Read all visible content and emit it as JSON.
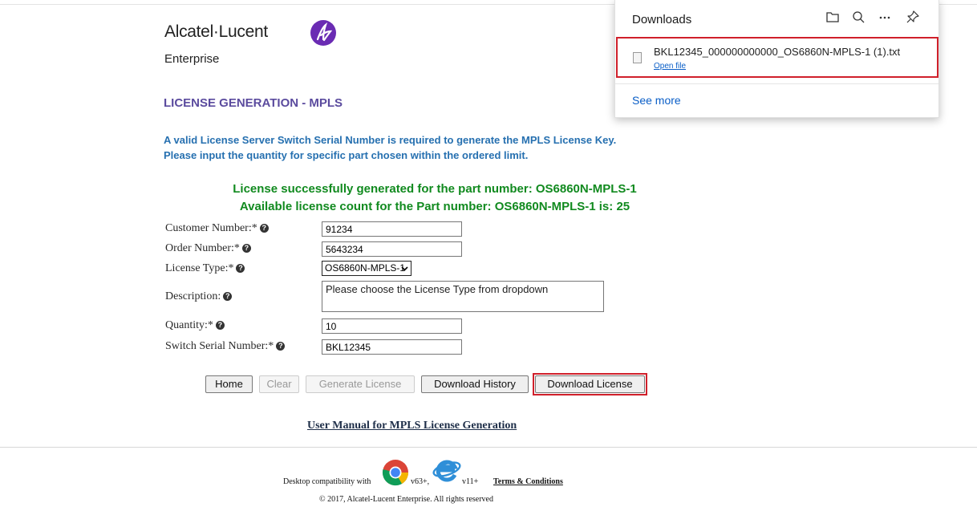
{
  "logo": {
    "brand": "Alcatel·Lucent",
    "sub": "Enterprise",
    "brand_color": "#6a2bb3"
  },
  "page": {
    "title": "LICENSE GENERATION - MPLS",
    "intro_line1": "A valid License Server Switch Serial Number is required to generate the MPLS License Key.",
    "intro_line2": "Please input the quantity for specific part chosen within the ordered limit.",
    "success_line1": "License successfully generated for the part number: OS6860N-MPLS-1",
    "success_line2": "Available license count for the Part number: OS6860N-MPLS-1 is: 25"
  },
  "form": {
    "customer_number": {
      "label": "Customer Number:*",
      "value": "91234"
    },
    "order_number": {
      "label": "Order Number:*",
      "value": "5643234"
    },
    "license_type": {
      "label": "License Type:*",
      "value": "OS6860N-MPLS-1"
    },
    "description": {
      "label": "Description:",
      "value": "Please choose the License Type from dropdown"
    },
    "quantity": {
      "label": "Quantity:*",
      "value": "10"
    },
    "switch_serial": {
      "label": "Switch Serial Number:*",
      "value": "BKL12345"
    }
  },
  "buttons": {
    "home": "Home",
    "clear": "Clear",
    "generate": "Generate License",
    "history": "Download History",
    "download": "Download License"
  },
  "manual_link": "User Manual for MPLS License Generation",
  "footer": {
    "compat": "Desktop compatibility with",
    "chrome_version": "v63+,",
    "ie_version": "v11+",
    "terms": "Terms & Conditions",
    "copyright": "© 2017, Alcatel-Lucent Enterprise. All rights reserved"
  },
  "downloads": {
    "title": "Downloads",
    "icons": [
      "folder-icon",
      "search-icon",
      "more-icon",
      "pin-icon"
    ],
    "file_name": "BKL12345_000000000000_OS6860N-MPLS-1 (1).txt",
    "open_file": "Open file",
    "see_more": "See more"
  },
  "colors": {
    "title_purple": "#5b4b9e",
    "intro_blue": "#2670b0",
    "success_green": "#118a1f",
    "highlight_red": "#d0202b",
    "link_blue": "#0a5ec7"
  }
}
